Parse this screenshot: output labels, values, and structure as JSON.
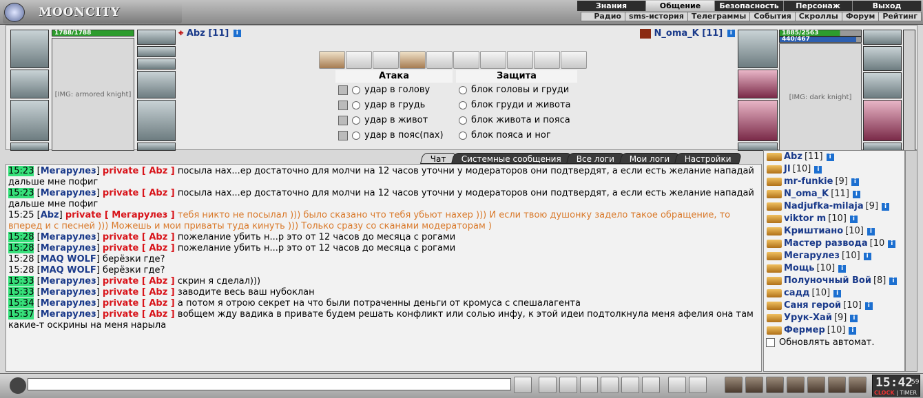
{
  "app": {
    "logo_text": "MOONCITY"
  },
  "menu_main": [
    "Знания",
    "Общение",
    "Безопасность",
    "Персонаж",
    "Выход"
  ],
  "menu_sub": [
    "Радио",
    "sms-история",
    "Телеграммы",
    "События",
    "Скроллы",
    "Форум",
    "Рейтинг"
  ],
  "player_left": {
    "name": "Abz",
    "level": "[11]",
    "hp": "1788/1788",
    "hp_fraction": 1.0
  },
  "player_right": {
    "name": "N_oma_K",
    "level": "[11]",
    "hp": "1885/2563",
    "mana": "440/467",
    "hp_fraction": 0.74,
    "mana_fraction": 0.94
  },
  "combat": {
    "attack_title": "Атака",
    "defense_title": "Защита",
    "attacks": [
      "удар в голову",
      "удар в грудь",
      "удар в живот",
      "удар в пояс(пах)"
    ],
    "blocks": [
      "блок головы и груди",
      "блок груди и живота",
      "блок живота и пояса",
      "блок пояса и ног"
    ]
  },
  "tabs": [
    "Чат",
    "Системные сообщения",
    "Все логи",
    "Мои логи",
    "Настройки"
  ],
  "chat": [
    {
      "time": "15:23",
      "nick": "Мегарулез",
      "priv": "private [ Abz ]",
      "text": "посыла нах...ер достаточно для молчи на 12 часов уточни у модераторов они подтвердят, а если есть желание нападай дальше мне пофиг"
    },
    {
      "time": "15:23",
      "nick": "Мегарулез",
      "priv": "private [ Abz ]",
      "text": "посыла нах...ер достаточно для молчи на 12 часов уточни у модераторов они подтвердят, а если есть желание нападай дальше мне пофиг"
    },
    {
      "time": "15:25",
      "nick": "Abz",
      "priv": "private [ Мегарулез ]",
      "text": "тебя никто не посылал ))) было сказано что тебя убьют нахер ))) И если твою душонку задело такое обращение, то вперед и с песней ))) Можешь и мои приваты туда кинуть ))) Только сразу со сканами модераторам )"
    },
    {
      "time": "15:28",
      "nick": "Мегарулез",
      "priv": "private [ Abz ]",
      "text": "пожелание убить н...р это от 12 часов до месяца с рогами"
    },
    {
      "time": "15:28",
      "nick": "Мегарулез",
      "priv": "private [ Abz ]",
      "text": "пожелание убить н...р это от 12 часов до месяца с рогами"
    },
    {
      "time": "15:28",
      "nick": "MAQ WOLF",
      "priv": "",
      "text": "берёзки где?"
    },
    {
      "time": "15:28",
      "nick": "MAQ WOLF",
      "priv": "",
      "text": "берёзки где?"
    },
    {
      "time": "15:33",
      "nick": "Мегарулез",
      "priv": "private [ Abz ]",
      "text": "скрин я сделал)))"
    },
    {
      "time": "15:33",
      "nick": "Мегарулез",
      "priv": "private [ Abz ]",
      "text": "заводите весь ваш нубоклан"
    },
    {
      "time": "15:34",
      "nick": "Мегарулез",
      "priv": "private [ Abz ]",
      "text": "а потом я отрою секрет на что были потраченны деньги от кромуса с спешалагента"
    },
    {
      "time": "15:37",
      "nick": "Мегарулез",
      "priv": "private [ Abz ]",
      "text": "вобщем жду вадика в привате будем решать конфликт или солью инфу, к этой идеи подтолкнула меня афелия она там какие-т оскрины на меня нарыла"
    }
  ],
  "users": [
    {
      "name": "Abz",
      "level": "[11]"
    },
    {
      "name": "JI",
      "level": "[10]"
    },
    {
      "name": "mr-funkie",
      "level": "[9]"
    },
    {
      "name": "N_oma_K",
      "level": "[11]"
    },
    {
      "name": "Nadjufka-milaja",
      "level": "[9]"
    },
    {
      "name": "viktor m",
      "level": "[10]"
    },
    {
      "name": "Криштиано",
      "level": "[10]"
    },
    {
      "name": "Мастер развода",
      "level": "[10"
    },
    {
      "name": "Мегарулез",
      "level": "[10]"
    },
    {
      "name": "Мощь",
      "level": "[10]"
    },
    {
      "name": "Полуночный Вой",
      "level": "[8]"
    },
    {
      "name": "садд",
      "level": "[10]"
    },
    {
      "name": "Саня герой",
      "level": "[10]"
    },
    {
      "name": "Урук-Хай",
      "level": "[9]"
    },
    {
      "name": "Фермер",
      "level": "[10]"
    }
  ],
  "auto_refresh_label": "Обновлять автомат.",
  "clock": {
    "time": "15:42",
    "seconds": "59",
    "label_clock": "CLOCK",
    "label_timer": "TIMER"
  },
  "colors": {
    "timestamp_bg": "#36e07a",
    "private": "#d8141a",
    "nick": "#1a3a8a",
    "own_message": "#d9792a"
  }
}
